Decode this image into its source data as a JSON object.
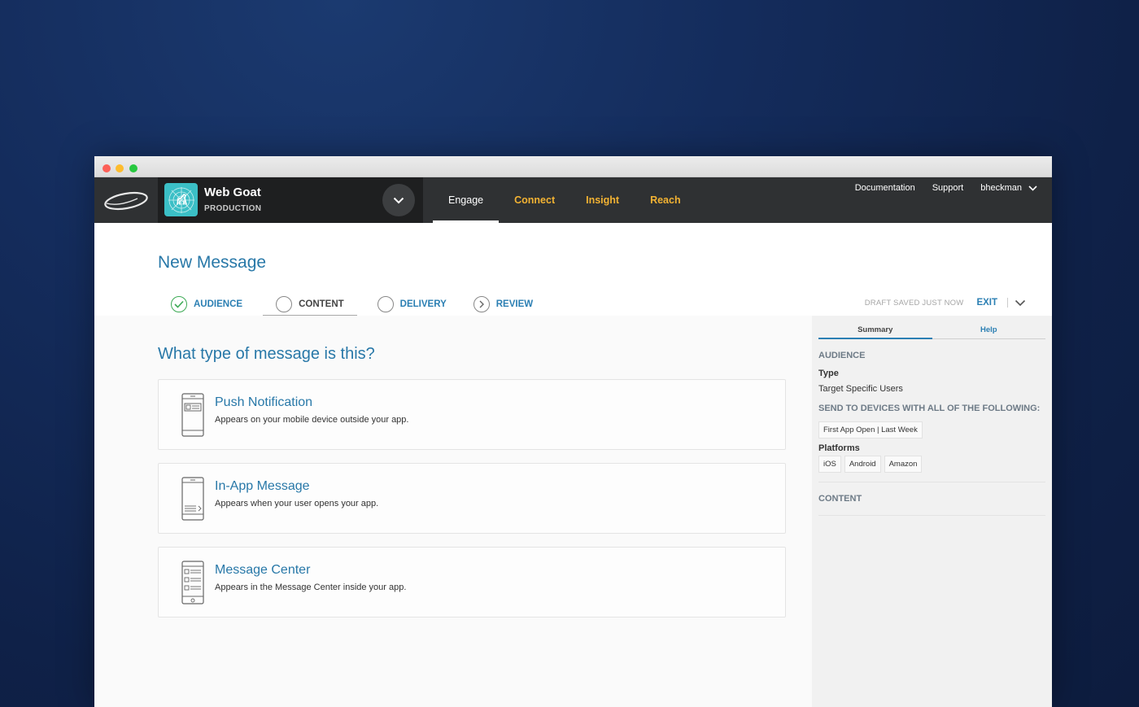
{
  "nav": {
    "app_name": "Web Goat",
    "app_env": "PRODUCTION",
    "tabs": [
      {
        "label": "Engage"
      },
      {
        "label": "Connect"
      },
      {
        "label": "Insight"
      },
      {
        "label": "Reach"
      }
    ],
    "links": {
      "documentation": "Documentation",
      "support": "Support",
      "user": "bheckman"
    }
  },
  "page": {
    "title": "New Message",
    "steps": [
      {
        "label": "AUDIENCE",
        "state": "complete"
      },
      {
        "label": "CONTENT",
        "state": "current"
      },
      {
        "label": "DELIVERY",
        "state": "pending"
      },
      {
        "label": "REVIEW",
        "state": "next"
      }
    ],
    "draft_status": "DRAFT SAVED JUST NOW",
    "exit_label": "EXIT"
  },
  "main": {
    "question": "What type of message is this?",
    "options": [
      {
        "title": "Push Notification",
        "description": "Appears on your mobile device outside your app.",
        "icon": "phone-push-icon"
      },
      {
        "title": "In-App Message",
        "description": "Appears when your user opens your app.",
        "icon": "phone-inapp-icon"
      },
      {
        "title": "Message Center",
        "description": "Appears in the Message Center inside your app.",
        "icon": "phone-message-center-icon"
      }
    ]
  },
  "summary": {
    "tabs": [
      {
        "label": "Summary"
      },
      {
        "label": "Help"
      }
    ],
    "audience_heading": "AUDIENCE",
    "type_label": "Type",
    "type_value": "Target Specific Users",
    "send_heading": "SEND TO DEVICES WITH ALL OF THE FOLLOWING:",
    "conditions": [
      "First App Open | Last Week"
    ],
    "platforms_label": "Platforms",
    "platforms": [
      "iOS",
      "Android",
      "Amazon"
    ],
    "content_heading": "CONTENT"
  },
  "colors": {
    "accent_blue": "#2878a8",
    "nav_gold": "#f2b233",
    "nav_dark": "#2f3133",
    "success_green": "#3daa55",
    "app_icon_teal": "#3bbfc6"
  }
}
